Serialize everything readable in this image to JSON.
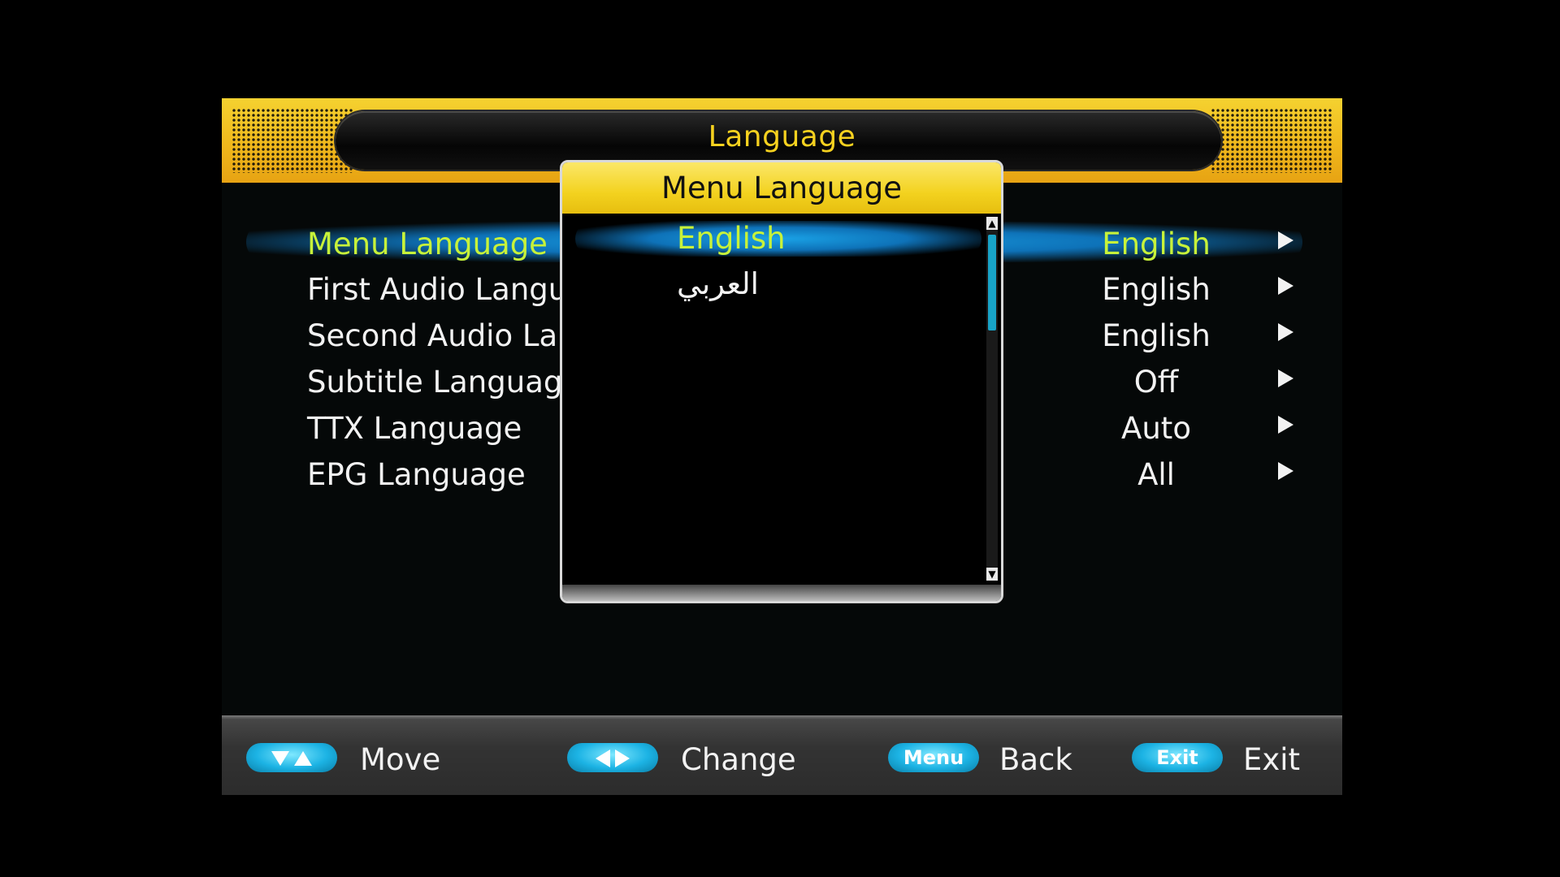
{
  "header": {
    "title": "Language"
  },
  "menu": {
    "items": [
      {
        "label": "Menu Language",
        "value": "English",
        "active": true
      },
      {
        "label": "First Audio Language",
        "value": "English",
        "active": false
      },
      {
        "label": "Second Audio Language",
        "value": "English",
        "active": false
      },
      {
        "label": "Subtitle Language",
        "value": "Off",
        "active": false
      },
      {
        "label": "TTX Language",
        "value": "Auto",
        "active": false
      },
      {
        "label": "EPG Language",
        "value": "All",
        "active": false
      }
    ]
  },
  "popup": {
    "title": "Menu Language",
    "options": [
      {
        "label": "English",
        "selected": true
      },
      {
        "label": "العربي",
        "selected": false
      }
    ]
  },
  "footer": {
    "move_label": "Move",
    "change_label": "Change",
    "menu_key": "Menu",
    "back_label": "Back",
    "exit_key": "Exit",
    "exit_label": "Exit"
  },
  "colors": {
    "accent_yellow": "#f6d11f",
    "highlight_blue": "#1aa2e6",
    "active_text": "#c7f23a",
    "button_cyan": "#1cb3e4"
  }
}
